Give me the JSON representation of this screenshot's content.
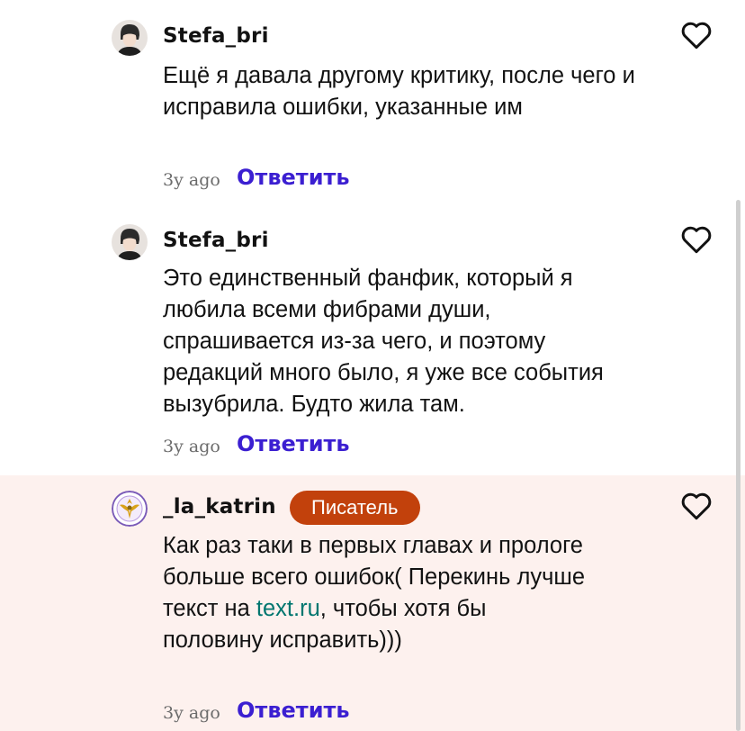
{
  "comments": [
    {
      "username": "Stefa_bri",
      "text": "Ещё я давала другому критику, после чего и исправила ошибки, указанные им",
      "time_ago": "3y ago",
      "reply_label": "Ответить"
    },
    {
      "username": "Stefa_bri",
      "text": "Это единственный фанфик, который я любила всеми фибрами души, спрашивается из-за чего, и поэтому редакций много было, я уже все события вызубрила. Будто жила там.",
      "time_ago": "3y ago",
      "reply_label": "Ответить"
    },
    {
      "username": "_la_katrin",
      "badge": "Писатель",
      "text_before": "Как раз таки в первых главах и прологе больше всего ошибок( Перекинь лучше текст на ",
      "link": "text.ru",
      "text_after": ", чтобы хотя бы половину исправить)))",
      "time_ago": "3y ago",
      "reply_label": "Ответить"
    }
  ],
  "icons": {
    "like": "heart-icon",
    "avatar_user": "user-avatar-icon",
    "avatar_author": "emblem-avatar-icon"
  },
  "colors": {
    "reply": "#3b1fd1",
    "badge": "#c2410c",
    "link": "#00766f",
    "highlight_bg": "#fdf1ee"
  }
}
